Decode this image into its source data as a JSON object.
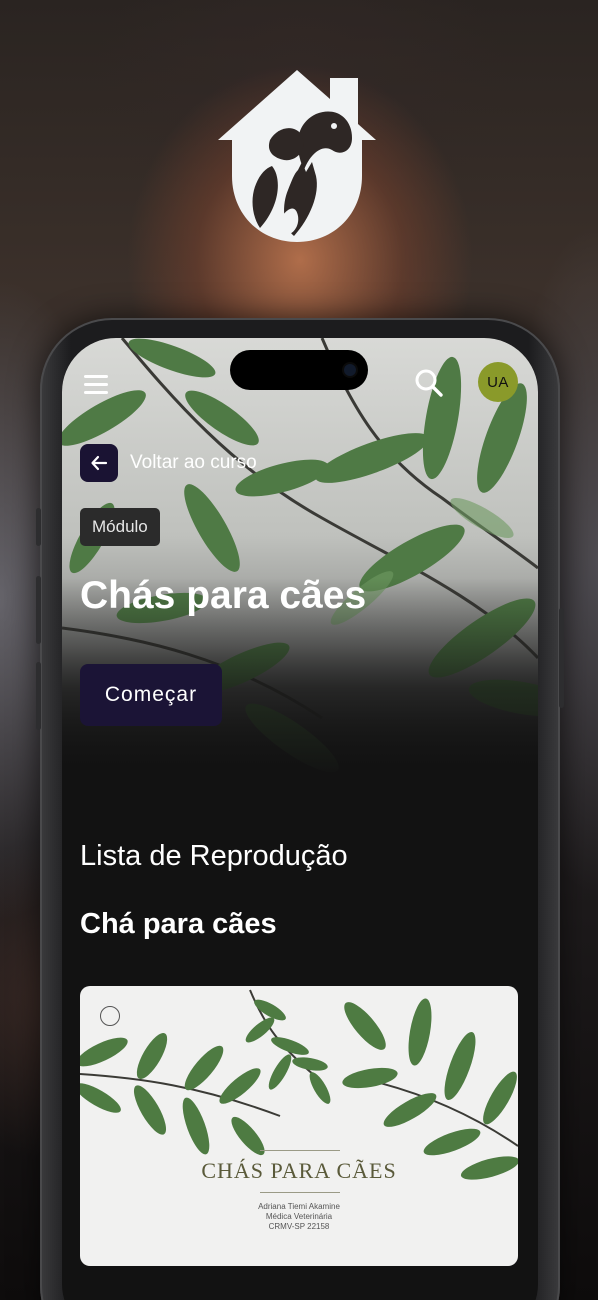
{
  "logo": {
    "icon": "house-dog-cat-icon",
    "color": "#f1f3f4"
  },
  "header": {
    "menu_icon": "menu-icon",
    "search_icon": "search-icon",
    "avatar_initials": "UA",
    "avatar_color": "#8a9a2a"
  },
  "navigation": {
    "back_label": "Voltar ao curso",
    "back_icon": "arrow-left-icon"
  },
  "module": {
    "badge": "Módulo",
    "title": "Chás para cães",
    "start_button": "Começar",
    "accent_color": "#1b1436"
  },
  "playlist": {
    "section_title": "Lista de Reprodução",
    "subsection_title": "Chá para cães",
    "card": {
      "title": "CHÁS PARA CÃES",
      "author": "Adriana Tiemi Akamine",
      "role": "Médica Veterinária",
      "crmv": "CRMV-SP 22158",
      "completed": false
    }
  }
}
